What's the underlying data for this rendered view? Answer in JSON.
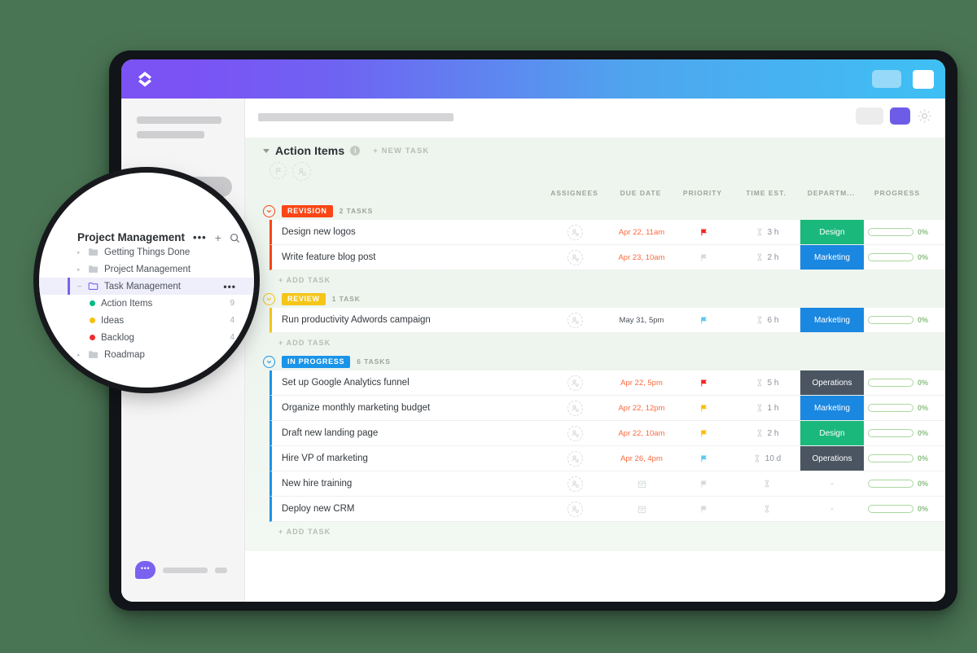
{
  "background_color": "#4a7554",
  "app": {
    "topbar": {
      "logo_icon": "clickup-chevrons-logo",
      "pill_label": "",
      "square_label": ""
    },
    "sidebar": {
      "search_placeholder": "",
      "chat_bubble_label": "•••"
    },
    "main_toolbar": {
      "gear_icon": "gear-icon"
    }
  },
  "list": {
    "title": "Action Items",
    "info_icon": "info-icon",
    "new_task_label": "+ NEW TASK",
    "quick_icons": [
      "flag-icon",
      "add-assignee-icon"
    ],
    "add_task_label": "+ ADD TASK"
  },
  "columns": [
    {
      "label": "ASSIGNEES"
    },
    {
      "label": "DUE DATE"
    },
    {
      "label": "PRIORITY"
    },
    {
      "label": "TIME EST."
    },
    {
      "label": "DEPARTM..."
    },
    {
      "label": "PROGRESS"
    }
  ],
  "groups": [
    {
      "status": "REVISION",
      "color": "#fa4616",
      "count_label": "2 TASKS",
      "tasks": [
        {
          "name": "Design new logos",
          "due": "Apr 22, 11am",
          "due_state": "overdue",
          "priority_color": "#f5241f",
          "time": "3 h",
          "dept": "Design",
          "dept_color": "#1ab97b",
          "progress": "0%"
        },
        {
          "name": "Write feature blog post",
          "due": "Apr 23, 10am",
          "due_state": "overdue",
          "priority_color": "#d6dade",
          "time": "2 h",
          "dept": "Marketing",
          "dept_color": "#1a87e0",
          "progress": "0%"
        }
      ]
    },
    {
      "status": "REVIEW",
      "color": "#f5c518",
      "count_label": "1 TASK",
      "tasks": [
        {
          "name": "Run productivity Adwords campaign",
          "due": "May 31, 5pm",
          "due_state": "normal",
          "priority_color": "#5ec7ef",
          "time": "6 h",
          "dept": "Marketing",
          "dept_color": "#1a87e0",
          "progress": "0%"
        }
      ]
    },
    {
      "status": "IN PROGRESS",
      "color": "#1a94e8",
      "count_label": "6 TASKS",
      "tasks": [
        {
          "name": "Set up Google Analytics funnel",
          "due": "Apr 22, 5pm",
          "due_state": "overdue",
          "priority_color": "#f5241f",
          "time": "5 h",
          "dept": "Operations",
          "dept_color": "#4a5561",
          "progress": "0%"
        },
        {
          "name": "Organize monthly marketing budget",
          "due": "Apr 22, 12pm",
          "due_state": "overdue",
          "priority_color": "#fbbd08",
          "time": "1 h",
          "dept": "Marketing",
          "dept_color": "#1a87e0",
          "progress": "0%"
        },
        {
          "name": "Draft new landing page",
          "due": "Apr 22, 10am",
          "due_state": "overdue",
          "priority_color": "#fbbd08",
          "time": "2 h",
          "dept": "Design",
          "dept_color": "#1ab97b",
          "progress": "0%"
        },
        {
          "name": "Hire VP of marketing",
          "due": "Apr 26, 4pm",
          "due_state": "overdue",
          "priority_color": "#5ec7ef",
          "time": "10 d",
          "dept": "Operations",
          "dept_color": "#4a5561",
          "progress": "0%"
        },
        {
          "name": "New hire training",
          "due": "",
          "due_state": "empty",
          "priority_color": "#d6dade",
          "time": "",
          "dept": "-",
          "dept_color": "",
          "progress": "0%"
        },
        {
          "name": "Deploy new CRM",
          "due": "",
          "due_state": "empty",
          "priority_color": "#d6dade",
          "time": "",
          "dept": "-",
          "dept_color": "",
          "progress": "0%"
        }
      ]
    }
  ],
  "magnifier": {
    "title": "Project Management",
    "dots_label": "•••",
    "plus_label": "+",
    "search_icon": "search-icon",
    "items": [
      {
        "label": "Getting Things Done",
        "type": "folder",
        "count": ""
      },
      {
        "label": "Project Management",
        "type": "folder",
        "count": ""
      },
      {
        "label": "Task Management",
        "type": "folder-open",
        "count": "",
        "active": true,
        "dots": "•••"
      },
      {
        "label": "Action Items",
        "type": "list",
        "dot_color": "#00b884",
        "count": "9"
      },
      {
        "label": "Ideas",
        "type": "list",
        "dot_color": "#fbbd08",
        "count": "4"
      },
      {
        "label": "Backlog",
        "type": "list",
        "dot_color": "#f02c2c",
        "count": "4"
      },
      {
        "label": "Roadmap",
        "type": "folder",
        "count": ""
      }
    ]
  }
}
